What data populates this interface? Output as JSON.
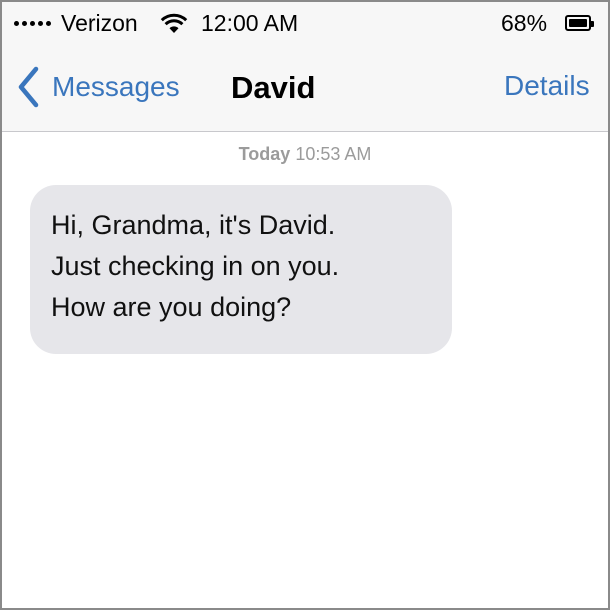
{
  "status_bar": {
    "signal_dots": 5,
    "carrier": "Verizon",
    "wifi_icon": "wifi-icon",
    "time": "12:00 AM",
    "battery_percent": "68%",
    "battery_icon": "battery-icon"
  },
  "nav": {
    "back_label": "Messages",
    "title": "David",
    "details_label": "Details",
    "accent_color": "#3a76bd"
  },
  "conversation": {
    "timestamp_day": "Today",
    "timestamp_time": "10:53 AM",
    "messages": [
      {
        "direction": "incoming",
        "lines": [
          "Hi, Grandma, it's David.",
          "Just checking in on you.",
          "How are you doing?"
        ]
      }
    ]
  }
}
